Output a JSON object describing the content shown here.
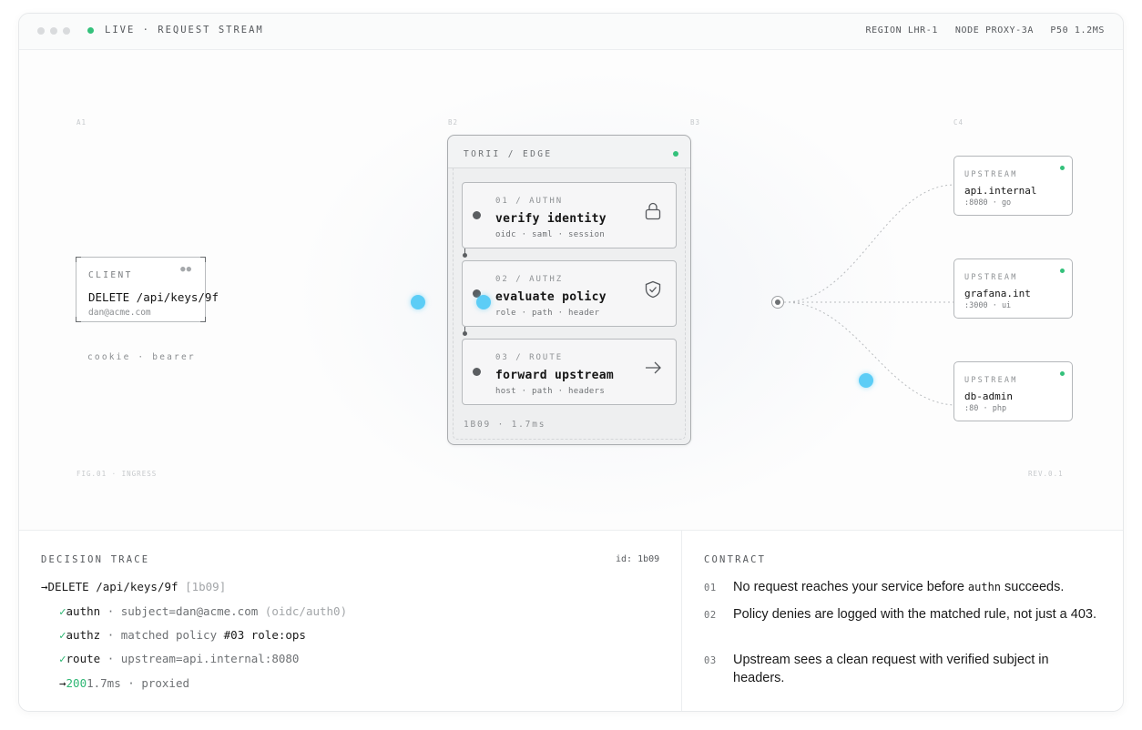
{
  "titlebar": {
    "title": "LIVE · REQUEST STREAM",
    "region": "REGION LHR-1",
    "node": "NODE PROXY-3A",
    "latency": "P50 1.2MS"
  },
  "grid_tags": {
    "a1": "A1",
    "b2": "B2",
    "b3": "B3",
    "c4": "C4",
    "figure": "FIG.01 · INGRESS",
    "revision": "REV.0.1"
  },
  "client": {
    "label": "CLIENT",
    "request": "DELETE /api/keys/9f",
    "user": "dan@acme.com",
    "caption": "cookie · bearer"
  },
  "edge": {
    "title": "TORII / EDGE",
    "footer": "1B09 · 1.7ms",
    "stages": [
      {
        "step": "01 / AUTHN",
        "name": "verify identity",
        "tags": "oidc · saml · session",
        "icon": "lock-icon"
      },
      {
        "step": "02 / AUTHZ",
        "name": "evaluate policy",
        "tags": "role · path · header",
        "icon": "shield-check-icon"
      },
      {
        "step": "03 / ROUTE",
        "name": "forward upstream",
        "tags": "host · path · headers",
        "icon": "arrow-right-icon"
      }
    ]
  },
  "upstreams": [
    {
      "label": "UPSTREAM",
      "name": "api.internal",
      "port": ":8080 · go"
    },
    {
      "label": "UPSTREAM",
      "name": "grafana.int",
      "port": ":3000 · ui"
    },
    {
      "label": "UPSTREAM",
      "name": "db-admin",
      "port": ":80 · php"
    }
  ],
  "trace": {
    "title": "DECISION TRACE",
    "id": "id: 1b09",
    "request_arrow": "→",
    "request": "DELETE /api/keys/9f",
    "request_id": "[1b09]",
    "check": "✓",
    "authn": {
      "key": "authn",
      "text": " · subject=dan@acme.com ",
      "extra": "(oidc/auth0)"
    },
    "authz": {
      "key": "authz",
      "text": " · matched policy ",
      "rule": "#03 role:ops"
    },
    "route": {
      "key": "route",
      "text": " · upstream=api.internal:8080"
    },
    "result": {
      "arrow": "→",
      "status": "200",
      "text": "1.7ms · proxied"
    }
  },
  "contract": {
    "title": "CONTRACT",
    "items": [
      {
        "num": "01",
        "text_before": "No request reaches your service before ",
        "code": "authn",
        "text_after": " succeeds."
      },
      {
        "num": "02",
        "text": "Policy denies are logged with the matched rule, not just a 403."
      },
      {
        "num": "03",
        "text": "Upstream sees a clean request with verified subject in headers."
      }
    ]
  },
  "colors": {
    "live": "#34c17b",
    "pulse": "#5ccdf6",
    "status_ok": "#2fb774"
  }
}
